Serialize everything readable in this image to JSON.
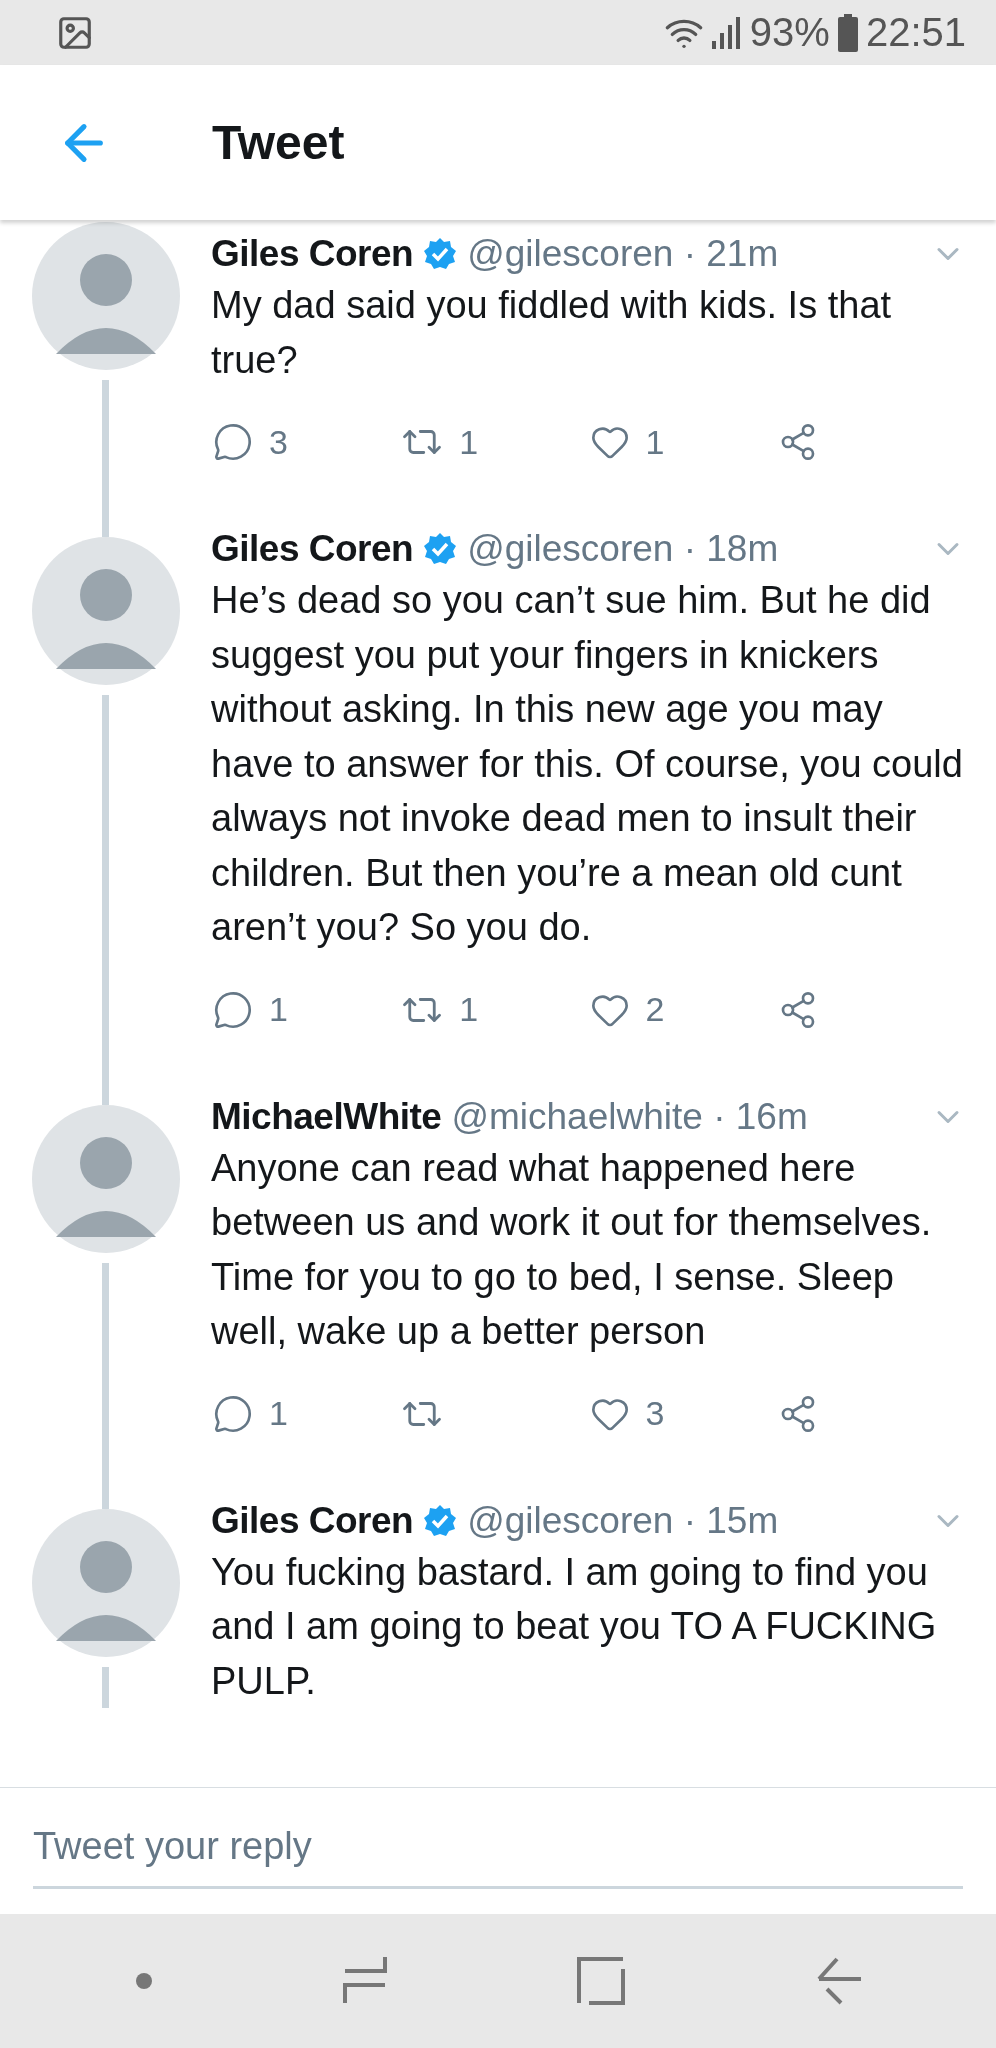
{
  "status_bar": {
    "battery": "93%",
    "time": "22:51"
  },
  "header": {
    "title": "Tweet"
  },
  "tweets": [
    {
      "name": "Giles Coren",
      "verified": true,
      "meta": "@gilescoren · 21m",
      "text": "My dad said you fiddled with kids. Is that true?",
      "replies": "3",
      "retweets": "1",
      "likes": "1"
    },
    {
      "name": "Giles Coren",
      "verified": true,
      "meta": "@gilescoren · 18m",
      "text": "He’s dead so you can’t sue him. But he did suggest you put your fingers in knickers without asking. In this new age you may have to answer for this. Of course, you could always not invoke dead men to insult their children. But then you’re a mean old cunt aren’t you? So you do.",
      "replies": "1",
      "retweets": "1",
      "likes": "2"
    },
    {
      "name": "MichaelWhite",
      "verified": false,
      "meta": "@michaelwhite · 16m",
      "text": "Anyone can read what happened here between us and work it out for themselves. Time for you to go to bed, I sense. Sleep well, wake up a better person",
      "replies": "1",
      "likes": "3"
    },
    {
      "name": "Giles Coren",
      "verified": true,
      "meta": "@gilescoren · 15m",
      "text": "You fucking bastard. I am going to find you and I am going to beat you TO A FUCKING PULP."
    }
  ],
  "reply_field": {
    "placeholder": "Tweet your reply"
  }
}
